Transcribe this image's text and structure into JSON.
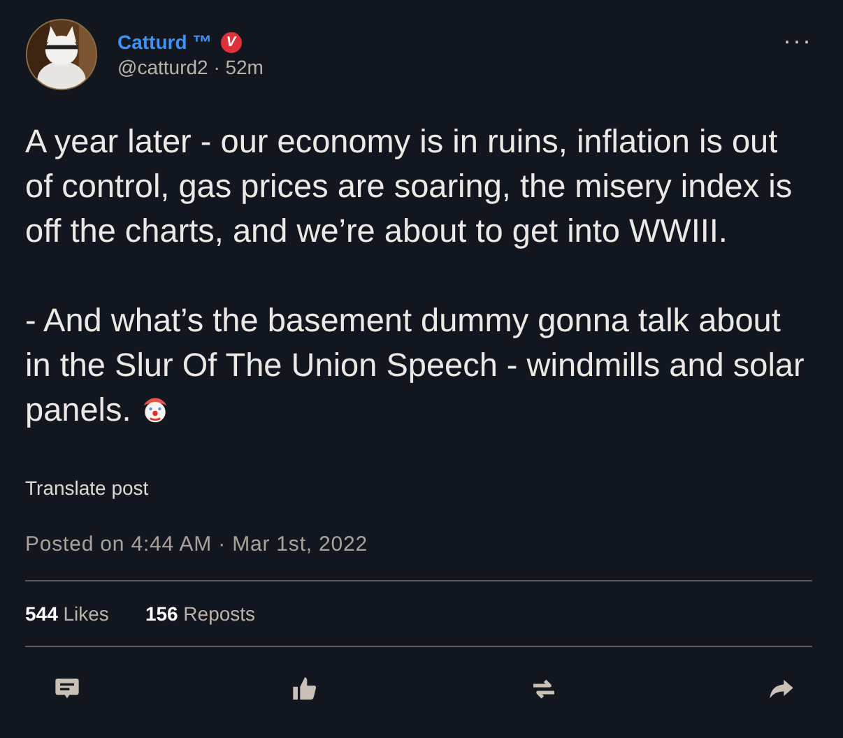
{
  "author": {
    "name": "Catturd ™",
    "verified": true,
    "handle": "@catturd2 · 52m"
  },
  "menu": "···",
  "paragraphs": [
    "A year later - our economy is in ruins, inflation is out of control, gas prices are soaring, the misery index is off the charts, and we’re about to get into WWIII.",
    "- And what’s the basement dummy gonna talk about in the Slur Of The Union Speech - windmills and solar panels."
  ],
  "verified_letter": "V",
  "translate": "Translate post",
  "posted": "Posted on 4:44 AM · Mar 1st, 2022",
  "stats": [
    {
      "count": "544",
      "label": "Likes"
    },
    {
      "count": "156",
      "label": "Reposts"
    }
  ]
}
